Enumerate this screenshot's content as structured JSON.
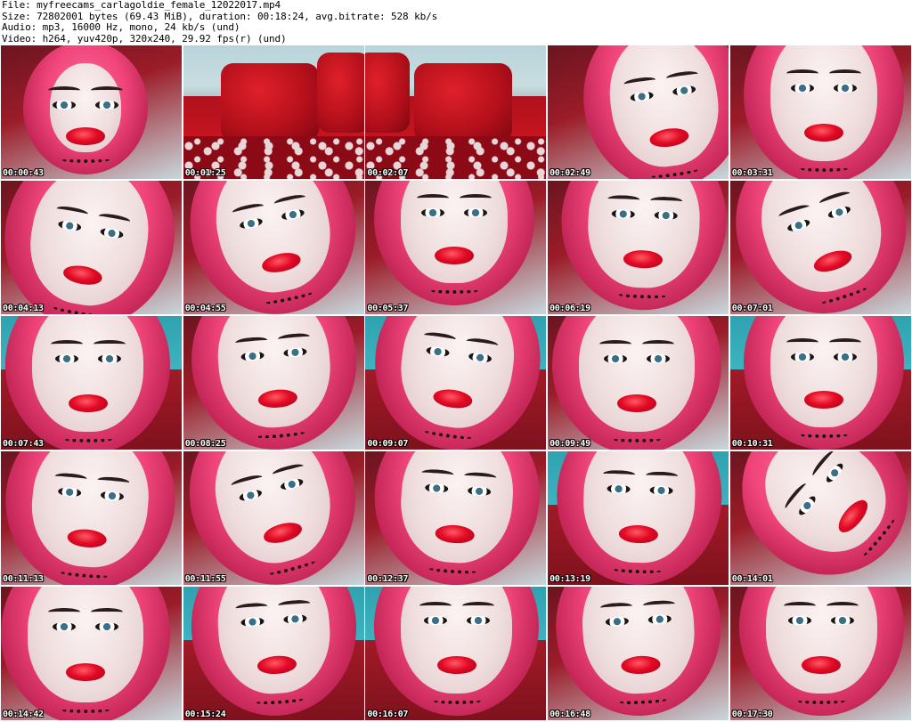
{
  "header": {
    "file_line": "File: myfreecams_carlagoldie_female_12022017.mp4",
    "size_line": "Size: 72802001 bytes (69.43 MiB), duration: 00:18:24, avg.bitrate: 528 kb/s",
    "audio_line": "Audio: mp3, 16000 Hz, mono, 24 kb/s (und)",
    "video_line": "Video: h264, yuv420p, 320x240, 29.92 fps(r) (und)"
  },
  "thumbnails": [
    {
      "timestamp": "00:00:43",
      "scene": "body"
    },
    {
      "timestamp": "00:01:25",
      "scene": "room"
    },
    {
      "timestamp": "00:02:07",
      "scene": "room"
    },
    {
      "timestamp": "00:02:49",
      "scene": "face"
    },
    {
      "timestamp": "00:03:31",
      "scene": "face"
    },
    {
      "timestamp": "00:04:13",
      "scene": "face"
    },
    {
      "timestamp": "00:04:55",
      "scene": "face"
    },
    {
      "timestamp": "00:05:37",
      "scene": "face"
    },
    {
      "timestamp": "00:06:19",
      "scene": "face"
    },
    {
      "timestamp": "00:07:01",
      "scene": "face"
    },
    {
      "timestamp": "00:07:43",
      "scene": "face-teal"
    },
    {
      "timestamp": "00:08:25",
      "scene": "face"
    },
    {
      "timestamp": "00:09:07",
      "scene": "face-teal"
    },
    {
      "timestamp": "00:09:49",
      "scene": "face"
    },
    {
      "timestamp": "00:10:31",
      "scene": "face-teal"
    },
    {
      "timestamp": "00:11:13",
      "scene": "face"
    },
    {
      "timestamp": "00:11:55",
      "scene": "face"
    },
    {
      "timestamp": "00:12:37",
      "scene": "face"
    },
    {
      "timestamp": "00:13:19",
      "scene": "face-teal"
    },
    {
      "timestamp": "00:14:01",
      "scene": "face"
    },
    {
      "timestamp": "00:14:42",
      "scene": "face"
    },
    {
      "timestamp": "00:15:24",
      "scene": "face-teal"
    },
    {
      "timestamp": "00:16:07",
      "scene": "face-teal"
    },
    {
      "timestamp": "00:16:48",
      "scene": "face"
    },
    {
      "timestamp": "00:17:30",
      "scene": "face"
    }
  ],
  "colors": {
    "hair": "#f0457a",
    "lips": "#e30a25",
    "wall": "#b8d4da",
    "pillow": "#c8151f"
  }
}
